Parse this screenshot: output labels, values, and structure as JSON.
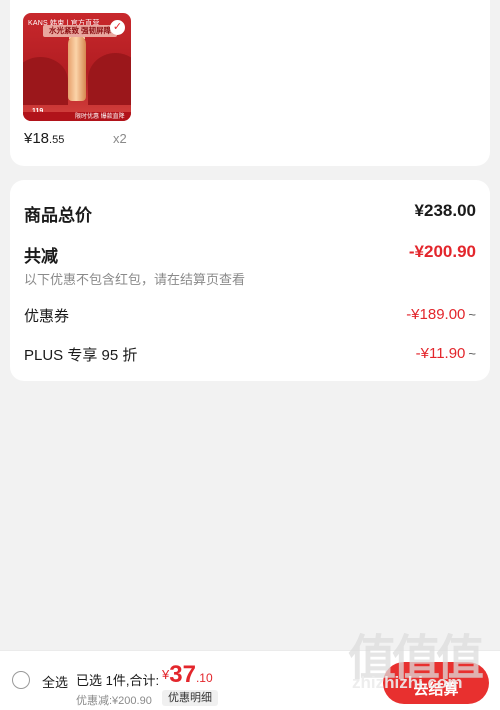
{
  "product": {
    "thumbnail": {
      "brand": "KANS 韩束 | 官方直营",
      "headline": "水光紧致 强韧屏障",
      "price_tag": "119",
      "strip_label": "限时优惠 爆款直降"
    },
    "unit_price_int": "¥18",
    "unit_price_dec": ".55",
    "quantity": "x2"
  },
  "summary": {
    "total_label": "商品总价",
    "total_value": "¥238.00",
    "reduce_label": "共减",
    "reduce_value": "-¥200.90",
    "reduce_note": "以下优惠不包含红包，请在结算页查看",
    "coupon_label": "优惠券",
    "coupon_value": "-¥189.00",
    "plus_label": "PLUS 专享 95 折",
    "plus_value": "-¥11.90",
    "expand_glyph": "~"
  },
  "bottom_bar": {
    "select_all_label": "全选",
    "selected_info": "已选 1件,合计:",
    "pay_currency": "¥",
    "pay_int": "37",
    "pay_dec": ".10",
    "discount_text": "优惠减:¥200.90",
    "detail_label": "优惠明细",
    "checkout_label": "去结算"
  },
  "watermark": {
    "glyphs": "值值值",
    "site": "zhizhizhi.com"
  },
  "colors": {
    "accent": "#e3262c",
    "checkout": "#e8302f",
    "background": "#f2f2f2"
  }
}
